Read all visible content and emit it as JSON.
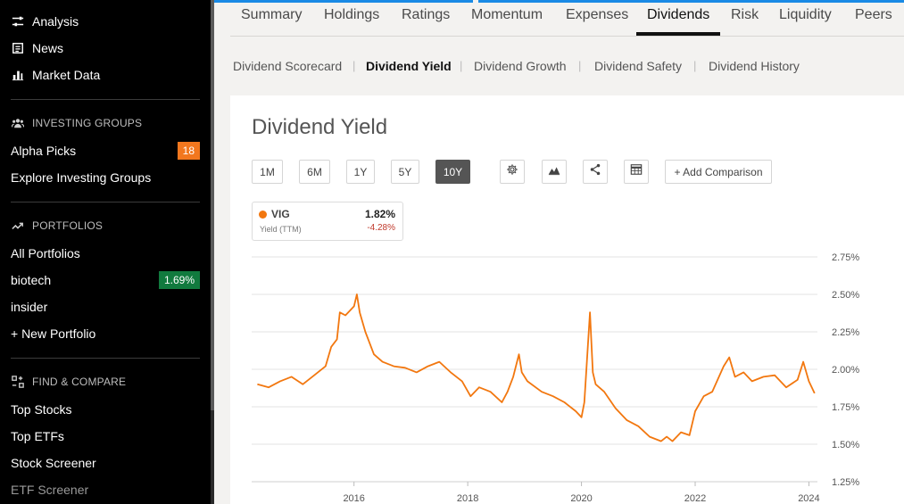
{
  "sidebar": {
    "top_items": [
      {
        "label": "Analysis",
        "icon": "sliders-icon"
      },
      {
        "label": "News",
        "icon": "newspaper-icon"
      },
      {
        "label": "Market Data",
        "icon": "bar-chart-icon"
      }
    ],
    "investing_groups": {
      "heading": "INVESTING GROUPS",
      "items": [
        {
          "label": "Alpha Picks",
          "badge": "18"
        },
        {
          "label": "Explore Investing Groups"
        }
      ]
    },
    "portfolios": {
      "heading": "PORTFOLIOS",
      "items": [
        {
          "label": "All Portfolios"
        },
        {
          "label": "biotech",
          "badge": "1.69%"
        },
        {
          "label": "insider"
        },
        {
          "label": "+ New Portfolio"
        }
      ]
    },
    "find_compare": {
      "heading": "FIND & COMPARE",
      "items": [
        {
          "label": "Top Stocks"
        },
        {
          "label": "Top ETFs"
        },
        {
          "label": "Stock Screener"
        },
        {
          "label": "ETF Screener"
        }
      ]
    }
  },
  "tabs": [
    "Summary",
    "Holdings",
    "Ratings",
    "Momentum",
    "Expenses",
    "Dividends",
    "Risk",
    "Liquidity",
    "Peers"
  ],
  "active_tab": "Dividends",
  "subtabs": [
    "Dividend Scorecard",
    "Dividend Yield",
    "Dividend Growth",
    "Dividend Safety",
    "Dividend History"
  ],
  "active_subtab": "Dividend Yield",
  "chart_panel": {
    "title": "Dividend Yield",
    "ranges": [
      "1M",
      "6M",
      "1Y",
      "5Y",
      "10Y"
    ],
    "active_range": "10Y",
    "tools": [
      "gear-icon",
      "mountain-chart-icon",
      "share-icon",
      "table-icon"
    ],
    "add_comparison": "+ Add Comparison",
    "legend": {
      "ticker": "VIG",
      "metric": "Yield (TTM)",
      "value": "1.82%",
      "change": "-4.28%"
    }
  },
  "colors": {
    "series": "#f2770f",
    "badge_orange": "#f2771e",
    "badge_green": "#117a3e",
    "change_negative": "#c0392b",
    "accent": "#1a8ae5"
  },
  "chart_data": {
    "type": "line",
    "title": "Dividend Yield",
    "series": [
      {
        "name": "VIG",
        "x": [
          2014.3,
          2014.5,
          2014.7,
          2014.9,
          2015.1,
          2015.3,
          2015.5,
          2015.6,
          2015.7,
          2015.75,
          2015.85,
          2016.0,
          2016.05,
          2016.1,
          2016.2,
          2016.35,
          2016.5,
          2016.7,
          2016.9,
          2017.1,
          2017.3,
          2017.5,
          2017.7,
          2017.9,
          2018.05,
          2018.2,
          2018.4,
          2018.6,
          2018.7,
          2018.8,
          2018.9,
          2018.95,
          2019.05,
          2019.3,
          2019.5,
          2019.7,
          2019.9,
          2020.0,
          2020.05,
          2020.15,
          2020.2,
          2020.25,
          2020.4,
          2020.6,
          2020.8,
          2021.0,
          2021.2,
          2021.4,
          2021.5,
          2021.6,
          2021.75,
          2021.9,
          2022.0,
          2022.15,
          2022.3,
          2022.5,
          2022.6,
          2022.7,
          2022.85,
          2023.0,
          2023.2,
          2023.4,
          2023.6,
          2023.8,
          2023.9,
          2024.0,
          2024.1
        ],
        "y": [
          1.9,
          1.88,
          1.92,
          1.95,
          1.9,
          1.96,
          2.02,
          2.15,
          2.2,
          2.38,
          2.36,
          2.42,
          2.5,
          2.38,
          2.25,
          2.1,
          2.05,
          2.02,
          2.01,
          1.98,
          2.02,
          2.05,
          1.98,
          1.92,
          1.82,
          1.88,
          1.85,
          1.78,
          1.85,
          1.95,
          2.1,
          1.98,
          1.92,
          1.85,
          1.82,
          1.78,
          1.72,
          1.68,
          1.78,
          2.38,
          1.98,
          1.9,
          1.85,
          1.74,
          1.66,
          1.62,
          1.55,
          1.52,
          1.55,
          1.52,
          1.58,
          1.56,
          1.72,
          1.82,
          1.85,
          2.02,
          2.08,
          1.95,
          1.98,
          1.92,
          1.95,
          1.96,
          1.88,
          1.93,
          2.05,
          1.92,
          1.84
        ]
      }
    ],
    "y_ticks": [
      "2.75%",
      "2.50%",
      "2.25%",
      "2.00%",
      "1.75%",
      "1.50%",
      "1.25%"
    ],
    "y_tick_values": [
      2.75,
      2.5,
      2.25,
      2.0,
      1.75,
      1.5,
      1.25
    ],
    "x_ticks": [
      "2016",
      "2018",
      "2020",
      "2022",
      "2024"
    ],
    "x_tick_values": [
      2016,
      2018,
      2020,
      2022,
      2024
    ],
    "xlim": [
      2014.2,
      2024.15
    ],
    "ylim": [
      1.25,
      2.75
    ],
    "grid": true,
    "legend": "top-left"
  }
}
